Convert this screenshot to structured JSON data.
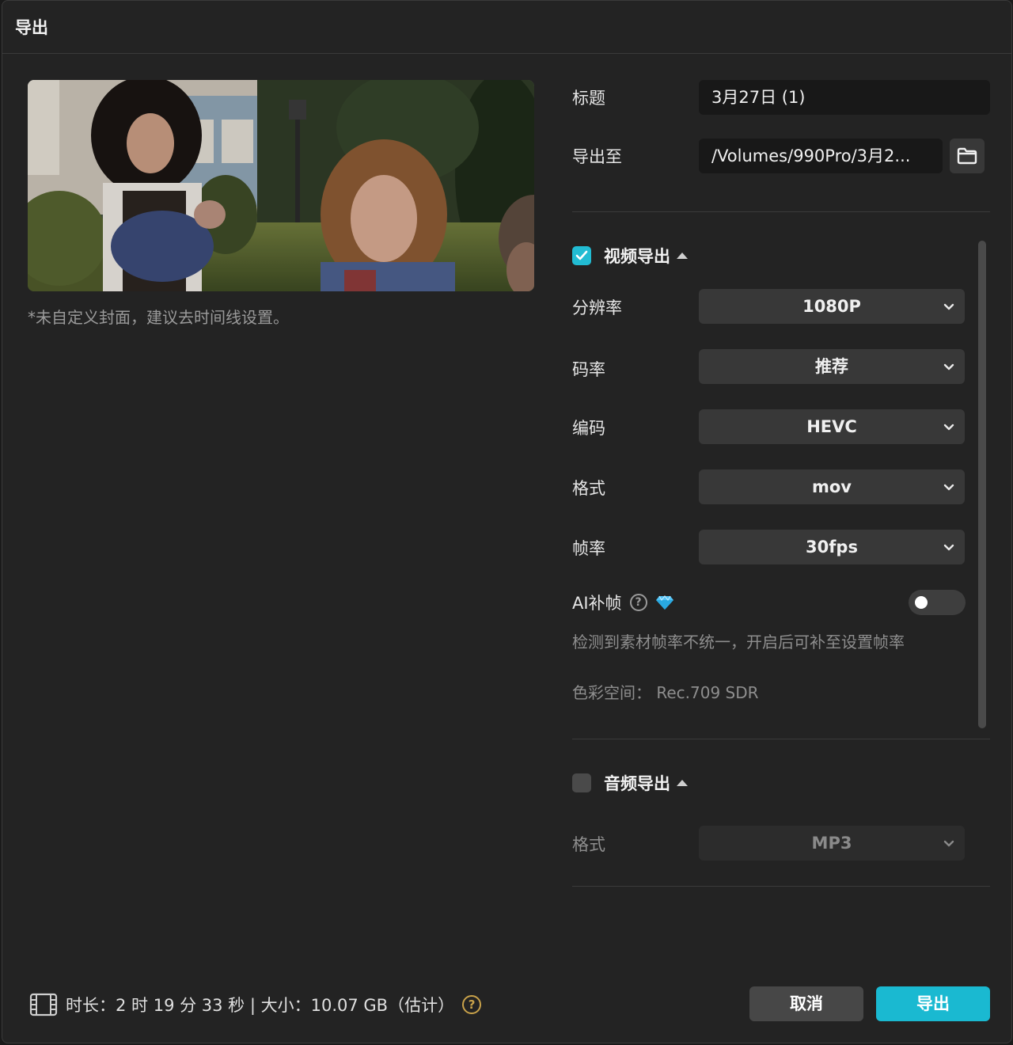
{
  "window": {
    "title": "导出"
  },
  "preview": {
    "cover_note": "*未自定义封面，建议去时间线设置。"
  },
  "fields": {
    "title_label": "标题",
    "title_value": "3月27日 (1)",
    "export_to_label": "导出至",
    "export_to_value": "/Volumes/990Pro/3月2..."
  },
  "video": {
    "enabled": true,
    "section_title": "视频导出",
    "resolution_label": "分辨率",
    "resolution_value": "1080P",
    "bitrate_label": "码率",
    "bitrate_value": "推荐",
    "codec_label": "编码",
    "codec_value": "HEVC",
    "format_label": "格式",
    "format_value": "mov",
    "framerate_label": "帧率",
    "framerate_value": "30fps",
    "ai_frame_label": "AI补帧",
    "ai_frame_enabled": false,
    "ai_frame_hint": "检测到素材帧率不统一，开启后可补至设置帧率",
    "color_space": "色彩空间： Rec.709 SDR"
  },
  "audio": {
    "enabled": false,
    "section_title": "音频导出",
    "format_label": "格式",
    "format_value": "MP3"
  },
  "footer": {
    "info": "时长：2 时 19 分 33 秒 | 大小：10.07 GB（估计）",
    "cancel_label": "取消",
    "export_label": "导出"
  },
  "icons": {
    "help": "?",
    "warning": "?"
  },
  "colors": {
    "accent": "#1ab9d1",
    "background": "#232323",
    "premium_gem": "#4fc3f7"
  }
}
